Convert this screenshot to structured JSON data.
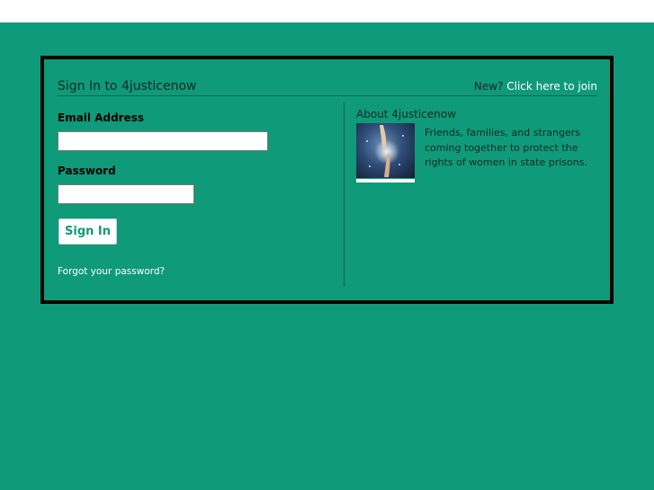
{
  "panel": {
    "title": "Sign In to 4justicenow",
    "join_prefix": "New?",
    "join_link": "Click here to join"
  },
  "form": {
    "email_label": "Email Address",
    "email_value": "",
    "password_label": "Password",
    "password_value": "",
    "signin_label": "Sign In",
    "forgot_label": "Forgot your password?"
  },
  "about": {
    "title": "About 4justicenow",
    "thumb_icon": "reaching-hands-image",
    "text": "Friends, families, and strangers coming together to protect the rights of women in state prisons."
  },
  "colors": {
    "background": "#0f9a7a",
    "panel_border": "#000000",
    "link": "#ffffff",
    "button_text": "#0f9a7a"
  }
}
